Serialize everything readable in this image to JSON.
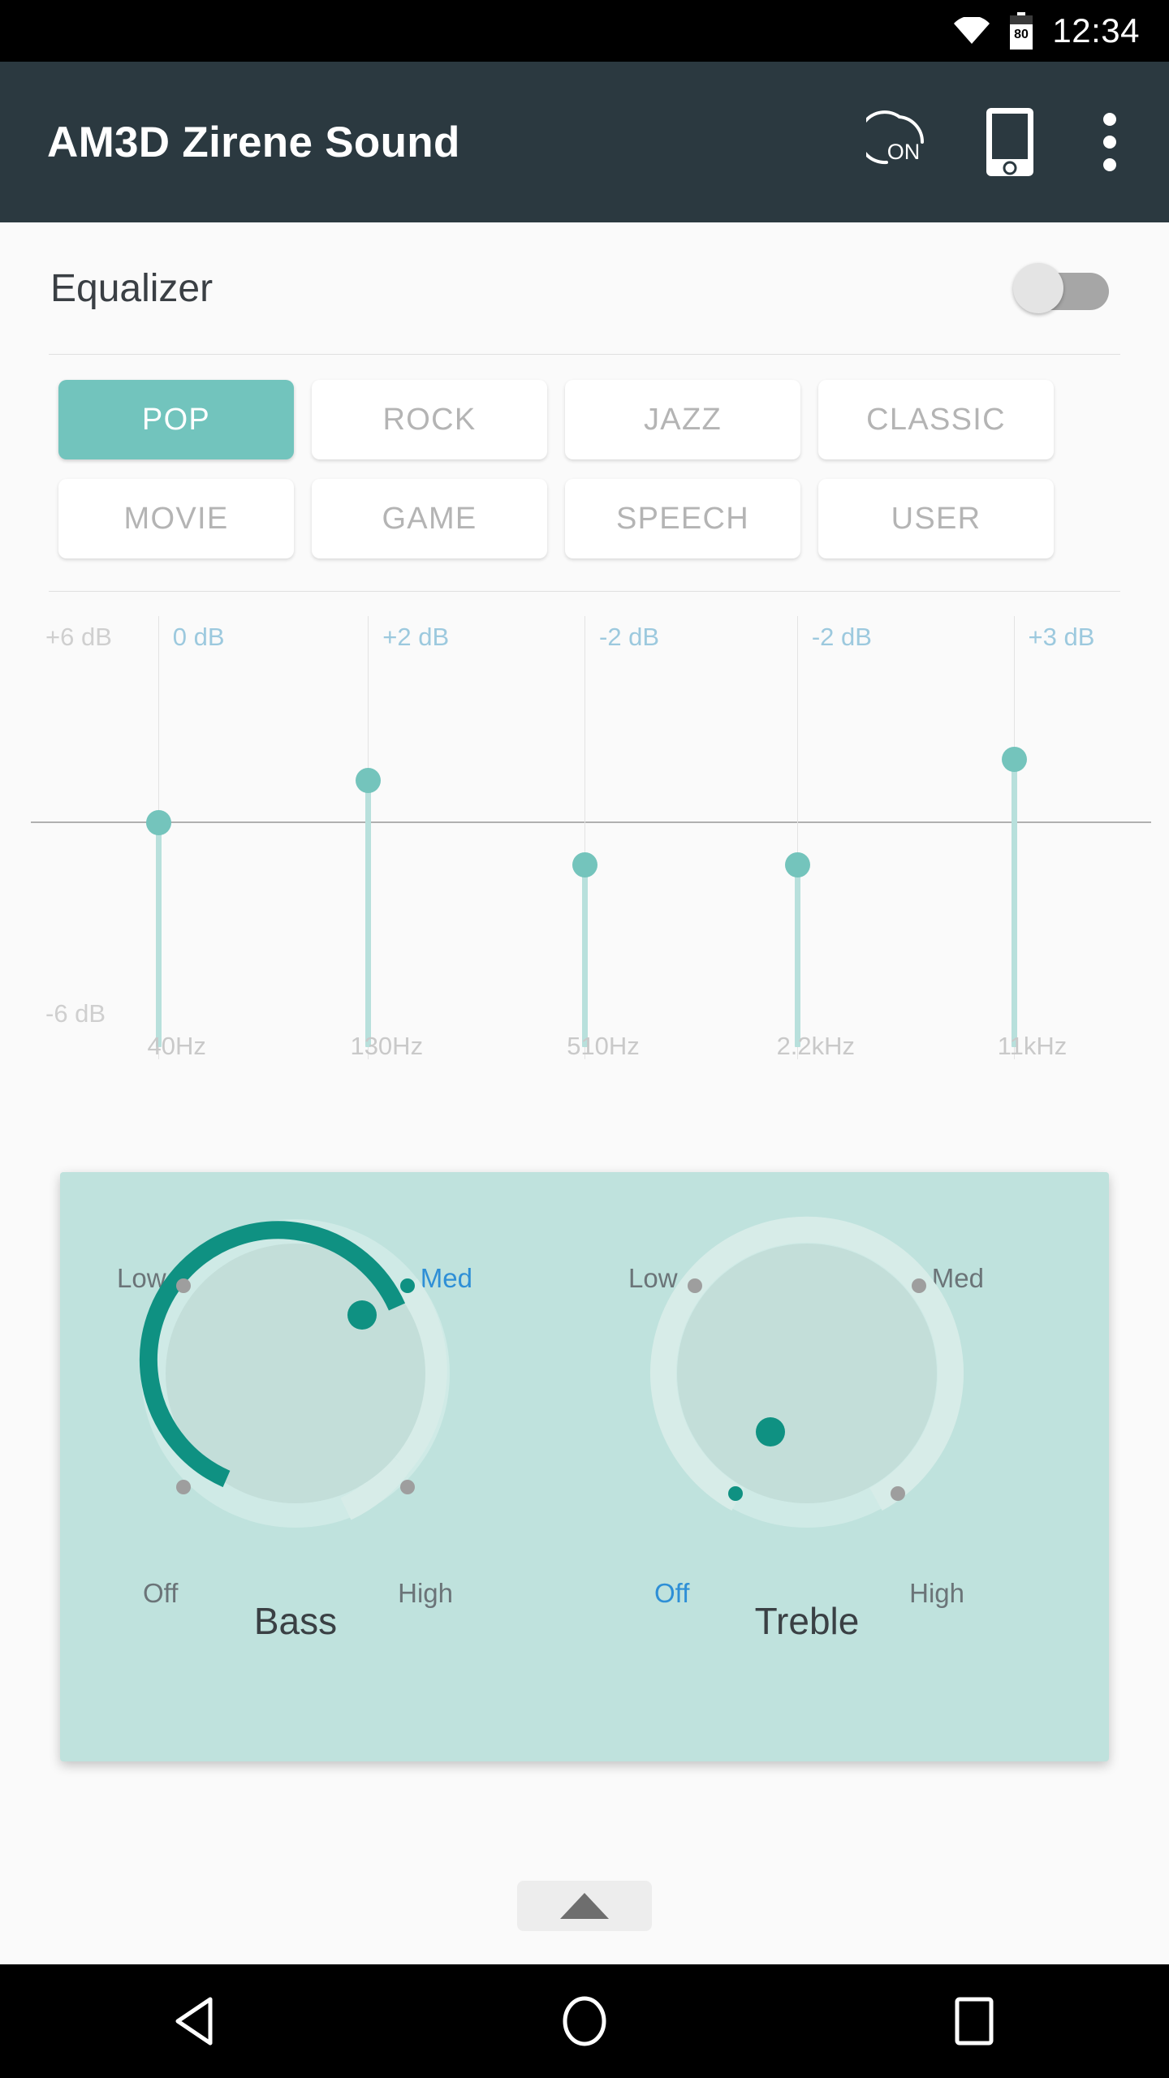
{
  "status_bar": {
    "time": "12:34",
    "battery_level": "80",
    "wifi_icon": "wifi-icon",
    "battery_icon": "battery-icon"
  },
  "app_bar": {
    "title": "AM3D Zirene Sound",
    "power_label": "ON",
    "actions": [
      {
        "name": "power-toggle-icon",
        "label": "ON"
      },
      {
        "name": "device-icon",
        "label": ""
      },
      {
        "name": "overflow-menu-icon",
        "label": ""
      }
    ],
    "background_color": "#2b3940"
  },
  "equalizer": {
    "title": "Equalizer",
    "enabled": false,
    "toggle_state": "off",
    "presets": [
      {
        "label": "POP",
        "active": true
      },
      {
        "label": "ROCK",
        "active": false
      },
      {
        "label": "JAZZ",
        "active": false
      },
      {
        "label": "CLASSIC",
        "active": false
      },
      {
        "label": "MOVIE",
        "active": false
      },
      {
        "label": "GAME",
        "active": false
      },
      {
        "label": "SPEECH",
        "active": false
      },
      {
        "label": "USER",
        "active": false
      }
    ],
    "accent_color": "#72c4bd"
  },
  "chart_data": {
    "type": "bar",
    "title": "Equalizer bands",
    "xlabel": "",
    "ylabel": "dB",
    "ylim": [
      -6,
      6
    ],
    "axis_max_label": "+6 dB",
    "axis_min_label": "-6 dB",
    "grid": true,
    "categories": [
      "40Hz",
      "130Hz",
      "510Hz",
      "2.2kHz",
      "11kHz"
    ],
    "values": [
      0,
      2,
      -2,
      -2,
      3
    ],
    "value_labels": [
      "0 dB",
      "+2 dB",
      "-2 dB",
      "-2 dB",
      "+3 dB"
    ],
    "bar_color": "#b8e0dc",
    "handle_color": "#74c4bc",
    "label_color": "#9cc9de"
  },
  "tone_controls": {
    "card_color": "#bfe2dd",
    "arc_color": "#0f9182",
    "knobs": [
      {
        "name": "bass",
        "caption": "Bass",
        "value": "Med",
        "ticks": [
          {
            "label": "Low",
            "active": false
          },
          {
            "label": "Med",
            "active": true
          },
          {
            "label": "Off",
            "active": false
          },
          {
            "label": "High",
            "active": false
          }
        ]
      },
      {
        "name": "treble",
        "caption": "Treble",
        "value": "Off",
        "ticks": [
          {
            "label": "Low",
            "active": false
          },
          {
            "label": "Med",
            "active": false
          },
          {
            "label": "Off",
            "active": true
          },
          {
            "label": "High",
            "active": false
          }
        ]
      }
    ]
  },
  "collapse_button": {
    "name": "collapse-panel-button",
    "icon": "triangle-up-icon"
  },
  "nav_bar": {
    "back": "back-triangle-icon",
    "home": "home-circle-icon",
    "recents": "recents-square-icon"
  }
}
